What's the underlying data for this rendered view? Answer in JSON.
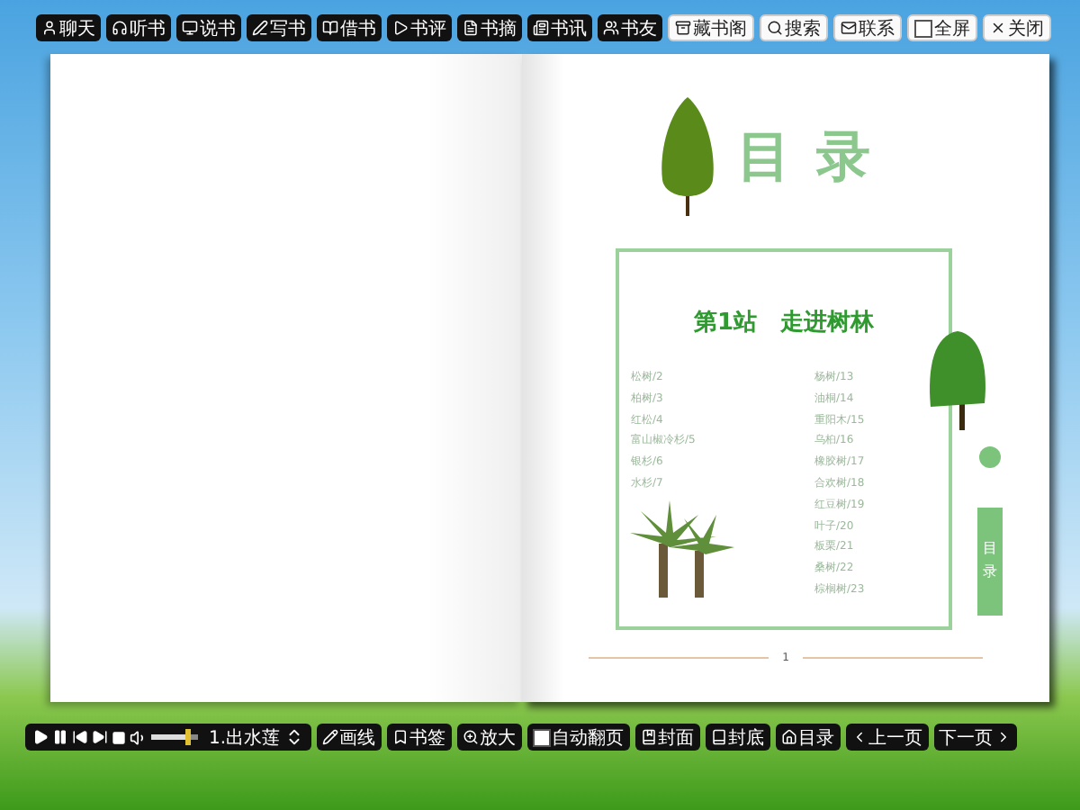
{
  "top_toolbar": {
    "dark_buttons": [
      {
        "label": "聊天"
      },
      {
        "label": "听书"
      },
      {
        "label": "说书"
      },
      {
        "label": "写书"
      },
      {
        "label": "借书"
      },
      {
        "label": "书评"
      },
      {
        "label": "书摘"
      },
      {
        "label": "书讯"
      },
      {
        "label": "书友"
      }
    ],
    "light_buttons": [
      {
        "label": "藏书阁"
      },
      {
        "label": "搜索"
      },
      {
        "label": "联系"
      }
    ],
    "fullscreen": {
      "label": "全屏",
      "checked": false
    },
    "close_button": {
      "label": "关闭"
    }
  },
  "book": {
    "right_page": {
      "title": "目录",
      "toc": {
        "heading": "第1站　走进树林",
        "column_1": [
          "松树/2",
          "柏树/3",
          "红松/4",
          "富山椒冷杉/5",
          "银杉/6",
          "水杉/7"
        ],
        "column_2": [
          "杨树/13",
          "油桐/14",
          "重阳木/15",
          "乌桕/16",
          "橡胶树/17",
          "合欢树/18",
          "红豆树/19",
          "叶子/20",
          "板栗/21",
          "桑树/22",
          "棕榈树/23"
        ]
      },
      "side_tab": "目录",
      "page_number": "1"
    }
  },
  "bottom_toolbar": {
    "volume": {
      "level": 0.8
    },
    "track": "1.出水莲",
    "buttons": [
      {
        "label": "画线",
        "kind": "button"
      },
      {
        "label": "书签",
        "kind": "button"
      },
      {
        "label": "放大",
        "kind": "button"
      },
      {
        "label": "自动翻页",
        "kind": "checkbox",
        "checked": false
      },
      {
        "label": "封面",
        "kind": "button"
      },
      {
        "label": "封底",
        "kind": "button"
      },
      {
        "label": "目录",
        "kind": "button"
      },
      {
        "label": "上一页",
        "kind": "button"
      },
      {
        "label": "下一页",
        "kind": "button"
      }
    ]
  }
}
